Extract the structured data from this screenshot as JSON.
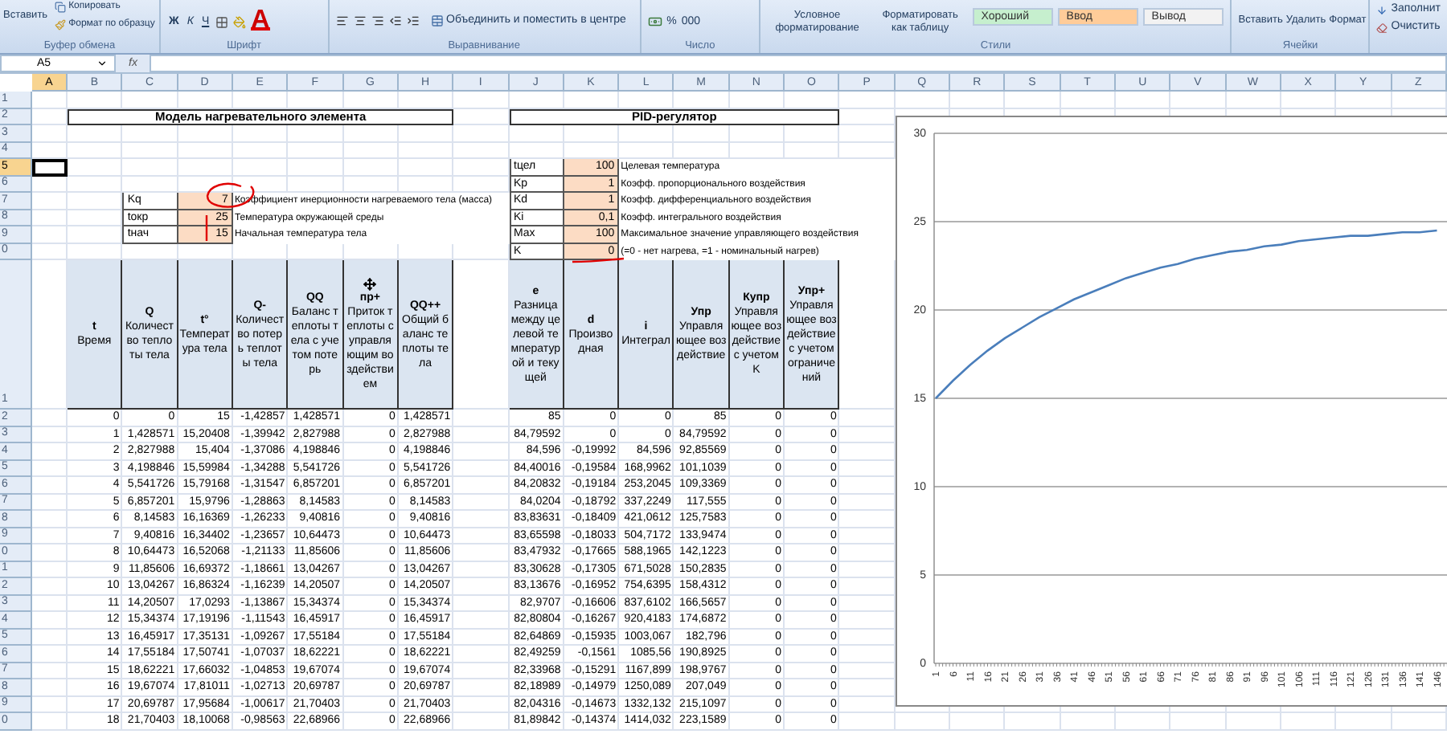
{
  "ribbon": {
    "clipboard": {
      "paste": "Вставить",
      "copy": "Копировать",
      "format_painter": "Формат по образцу",
      "label": "Буфер обмена"
    },
    "font": {
      "bold": "Ж",
      "italic": "К",
      "underline": "Ч",
      "font_color": "A",
      "label": "Шрифт"
    },
    "alignment": {
      "merge": "Объединить и поместить в центре",
      "label": "Выравнивание"
    },
    "number": {
      "percent": "%",
      "thousands": "000",
      "label": "Число"
    },
    "styles": {
      "conditional": "Условное форматирование",
      "format_table": "Форматировать как таблицу",
      "chips": [
        {
          "text": "Хороший",
          "color": "#c6efce"
        },
        {
          "text": "Ввод",
          "color": "#ffcc99"
        },
        {
          "text": "Вывод",
          "color": "#f2f2f2"
        }
      ],
      "label": "Стили"
    },
    "cells": {
      "insert": "Вставить",
      "delete": "Удалить",
      "format": "Формат",
      "label": "Ячейки"
    },
    "editing": {
      "fill": "Заполнит",
      "clear": "Очистить"
    }
  },
  "formula_bar": {
    "name_box": "A5",
    "function_label": "fx"
  },
  "columns": [
    {
      "label": "A",
      "selected": true
    },
    {
      "label": "B",
      "selected": false
    },
    {
      "label": "C",
      "selected": false
    },
    {
      "label": "D",
      "selected": false
    },
    {
      "label": "E",
      "selected": false
    },
    {
      "label": "F",
      "selected": false
    },
    {
      "label": "G",
      "selected": false
    },
    {
      "label": "H",
      "selected": false
    },
    {
      "label": "I",
      "selected": false
    },
    {
      "label": "J",
      "selected": false
    },
    {
      "label": "K",
      "selected": false
    },
    {
      "label": "L",
      "selected": false
    },
    {
      "label": "M",
      "selected": false
    },
    {
      "label": "N",
      "selected": false
    },
    {
      "label": "O",
      "selected": false
    },
    {
      "label": "P",
      "selected": false
    },
    {
      "label": "Q",
      "selected": false
    },
    {
      "label": "R",
      "selected": false
    },
    {
      "label": "S",
      "selected": false
    },
    {
      "label": "T",
      "selected": false
    },
    {
      "label": "U",
      "selected": false
    },
    {
      "label": "V",
      "selected": false
    },
    {
      "label": "W",
      "selected": false
    },
    {
      "label": "X",
      "selected": false
    },
    {
      "label": "Y",
      "selected": false
    },
    {
      "label": "Z",
      "selected": false
    }
  ],
  "row_headers": [
    {
      "label": "1",
      "selected": false
    },
    {
      "label": "2",
      "selected": false
    },
    {
      "label": "3",
      "selected": false
    },
    {
      "label": "4",
      "selected": false
    },
    {
      "label": "5",
      "selected": true
    },
    {
      "label": "6",
      "selected": false
    },
    {
      "label": "7",
      "selected": false
    },
    {
      "label": "8",
      "selected": false
    },
    {
      "label": "9",
      "selected": false
    },
    {
      "label": "0",
      "selected": false
    },
    {
      "label": "1",
      "selected": false
    },
    {
      "label": "2",
      "selected": false
    },
    {
      "label": "3",
      "selected": false
    },
    {
      "label": "4",
      "selected": false
    },
    {
      "label": "5",
      "selected": false
    },
    {
      "label": "6",
      "selected": false
    },
    {
      "label": "7",
      "selected": false
    },
    {
      "label": "8",
      "selected": false
    },
    {
      "label": "9",
      "selected": false
    },
    {
      "label": "0",
      "selected": false
    },
    {
      "label": "1",
      "selected": false
    },
    {
      "label": "2",
      "selected": false
    },
    {
      "label": "3",
      "selected": false
    },
    {
      "label": "4",
      "selected": false
    },
    {
      "label": "5",
      "selected": false
    },
    {
      "label": "6",
      "selected": false
    },
    {
      "label": "7",
      "selected": false
    },
    {
      "label": "8",
      "selected": false
    },
    {
      "label": "9",
      "selected": false
    },
    {
      "label": "0",
      "selected": false
    }
  ],
  "model": {
    "title": "Модель нагревательного элемента",
    "params": [
      {
        "name": "Kq",
        "value": "7",
        "description": "Коэффициент инерционности нагреваемого тела (масса)"
      },
      {
        "name": "tокр",
        "value": "25",
        "description": "Температура окружающей среды"
      },
      {
        "name": "tнач",
        "value": "15",
        "description": "Начальная температура тела"
      }
    ],
    "columns": [
      {
        "symbol": "t",
        "description": "Время",
        "cursor": false
      },
      {
        "symbol": "Q",
        "description": "Количество теплоты тела",
        "cursor": false
      },
      {
        "symbol": "t°",
        "description": "Температура тела",
        "cursor": false
      },
      {
        "symbol": "Q-",
        "description": "Количество потерь теплоты тела",
        "cursor": false
      },
      {
        "symbol": "QQ",
        "description": "Баланс теплоты тела с учетом потерь",
        "cursor": false
      },
      {
        "symbol": "пр+",
        "description": "Приток теплоты с управляющим воздействием",
        "cursor": true
      },
      {
        "symbol": "QQ++",
        "description": "Общий баланс теплоты тела",
        "cursor": false
      }
    ],
    "rows": [
      [
        "0",
        "0",
        "15",
        "-1,42857",
        "1,428571",
        "0",
        "1,428571"
      ],
      [
        "1",
        "1,428571",
        "15,20408",
        "-1,39942",
        "2,827988",
        "0",
        "2,827988"
      ],
      [
        "2",
        "2,827988",
        "15,404",
        "-1,37086",
        "4,198846",
        "0",
        "4,198846"
      ],
      [
        "3",
        "4,198846",
        "15,59984",
        "-1,34288",
        "5,541726",
        "0",
        "5,541726"
      ],
      [
        "4",
        "5,541726",
        "15,79168",
        "-1,31547",
        "6,857201",
        "0",
        "6,857201"
      ],
      [
        "5",
        "6,857201",
        "15,9796",
        "-1,28863",
        "8,14583",
        "0",
        "8,14583"
      ],
      [
        "6",
        "8,14583",
        "16,16369",
        "-1,26233",
        "9,40816",
        "0",
        "9,40816"
      ],
      [
        "7",
        "9,40816",
        "16,34402",
        "-1,23657",
        "10,64473",
        "0",
        "10,64473"
      ],
      [
        "8",
        "10,64473",
        "16,52068",
        "-1,21133",
        "11,85606",
        "0",
        "11,85606"
      ],
      [
        "9",
        "11,85606",
        "16,69372",
        "-1,18661",
        "13,04267",
        "0",
        "13,04267"
      ],
      [
        "10",
        "13,04267",
        "16,86324",
        "-1,16239",
        "14,20507",
        "0",
        "14,20507"
      ],
      [
        "11",
        "14,20507",
        "17,0293",
        "-1,13867",
        "15,34374",
        "0",
        "15,34374"
      ],
      [
        "12",
        "15,34374",
        "17,19196",
        "-1,11543",
        "16,45917",
        "0",
        "16,45917"
      ],
      [
        "13",
        "16,45917",
        "17,35131",
        "-1,09267",
        "17,55184",
        "0",
        "17,55184"
      ],
      [
        "14",
        "17,55184",
        "17,50741",
        "-1,07037",
        "18,62221",
        "0",
        "18,62221"
      ],
      [
        "15",
        "18,62221",
        "17,66032",
        "-1,04853",
        "19,67074",
        "0",
        "19,67074"
      ],
      [
        "16",
        "19,67074",
        "17,81011",
        "-1,02713",
        "20,69787",
        "0",
        "20,69787"
      ],
      [
        "17",
        "20,69787",
        "17,95684",
        "-1,00617",
        "21,70403",
        "0",
        "21,70403"
      ],
      [
        "18",
        "21,70403",
        "18,10068",
        "-0,98563",
        "22,68966",
        "0",
        "22,68966"
      ]
    ]
  },
  "pid": {
    "title": "PID-регулятор",
    "params": [
      {
        "name": "tцел",
        "value": "100",
        "description": "Целевая температура"
      },
      {
        "name": "Kp",
        "value": "1",
        "description": "Коэфф. пропорционального воздействия"
      },
      {
        "name": "Kd",
        "value": "1",
        "description": "Коэфф. дифференциального воздействия"
      },
      {
        "name": "Ki",
        "value": "0,1",
        "description": "Коэфф. интегрального воздействия"
      },
      {
        "name": "Max",
        "value": "100",
        "description": "Максимальное значение управляющего воздействия"
      },
      {
        "name": "K",
        "value": "0",
        "description": "(=0 - нет нагрева, =1 - номинальный нагрев)"
      }
    ],
    "columns": [
      {
        "symbol": "e",
        "description": "Разница между целевой температурой и текущей"
      },
      {
        "symbol": "d",
        "description": "Производная"
      },
      {
        "symbol": "i",
        "description": "Интеграл"
      },
      {
        "symbol": "Упр",
        "description": "Управляющее воздействие"
      },
      {
        "symbol": "Купр",
        "description": "Управляющее воздействие с учетом K"
      },
      {
        "symbol": "Упр+",
        "description": "Управляющее воздействие с учетом ограничений"
      }
    ],
    "rows": [
      [
        "85",
        "0",
        "0",
        "85",
        "0",
        "0"
      ],
      [
        "84,79592",
        "0",
        "0",
        "84,79592",
        "0",
        "0"
      ],
      [
        "84,596",
        "-0,19992",
        "84,596",
        "92,85569",
        "0",
        "0"
      ],
      [
        "84,40016",
        "-0,19584",
        "168,9962",
        "101,1039",
        "0",
        "0"
      ],
      [
        "84,20832",
        "-0,19184",
        "253,2045",
        "109,3369",
        "0",
        "0"
      ],
      [
        "84,0204",
        "-0,18792",
        "337,2249",
        "117,555",
        "0",
        "0"
      ],
      [
        "83,83631",
        "-0,18409",
        "421,0612",
        "125,7583",
        "0",
        "0"
      ],
      [
        "83,65598",
        "-0,18033",
        "504,7172",
        "133,9474",
        "0",
        "0"
      ],
      [
        "83,47932",
        "-0,17665",
        "588,1965",
        "142,1223",
        "0",
        "0"
      ],
      [
        "83,30628",
        "-0,17305",
        "671,5028",
        "150,2835",
        "0",
        "0"
      ],
      [
        "83,13676",
        "-0,16952",
        "754,6395",
        "158,4312",
        "0",
        "0"
      ],
      [
        "82,9707",
        "-0,16606",
        "837,6102",
        "166,5657",
        "0",
        "0"
      ],
      [
        "82,80804",
        "-0,16267",
        "920,4183",
        "174,6872",
        "0",
        "0"
      ],
      [
        "82,64869",
        "-0,15935",
        "1003,067",
        "182,796",
        "0",
        "0"
      ],
      [
        "82,49259",
        "-0,1561",
        "1085,56",
        "190,8925",
        "0",
        "0"
      ],
      [
        "82,33968",
        "-0,15291",
        "1167,899",
        "198,9767",
        "0",
        "0"
      ],
      [
        "82,18989",
        "-0,14979",
        "1250,089",
        "207,049",
        "0",
        "0"
      ],
      [
        "82,04316",
        "-0,14673",
        "1332,132",
        "215,1097",
        "0",
        "0"
      ],
      [
        "81,89842",
        "-0,14374",
        "1414,032",
        "223,1589",
        "0",
        "0"
      ]
    ]
  },
  "chart": {
    "chart_data": {
      "type": "line",
      "categories": [
        "1",
        "6",
        "11",
        "16",
        "21",
        "26",
        "31",
        "36",
        "41",
        "46",
        "51",
        "56",
        "61",
        "66",
        "71",
        "76",
        "81",
        "86",
        "91",
        "96",
        "101",
        "106",
        "111",
        "116",
        "121",
        "126",
        "131",
        "136",
        "141",
        "146"
      ],
      "series": [
        {
          "color": "#4a7ebb",
          "values": [
            15,
            16,
            16.9,
            17.7,
            18.4,
            19,
            19.6,
            20.1,
            20.6,
            21,
            21.4,
            21.8,
            22.1,
            22.4,
            22.6,
            22.9,
            23.1,
            23.3,
            23.4,
            23.6,
            23.7,
            23.9,
            24,
            24.1,
            24.2,
            24.2,
            24.3,
            24.4,
            24.4,
            24.5
          ]
        }
      ],
      "ylim": [
        0,
        30
      ],
      "yticks": [
        0,
        5,
        10,
        15,
        20,
        25,
        30
      ],
      "grid": true
    }
  }
}
